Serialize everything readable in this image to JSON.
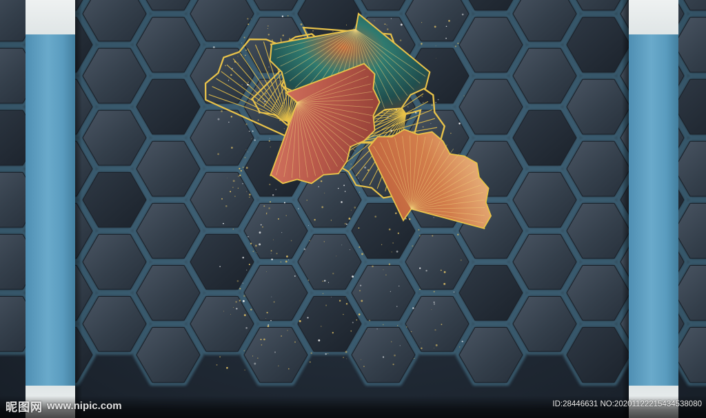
{
  "scene": {
    "subject": "ginkgo-leaves-on-hexagon-wall",
    "palette": {
      "background": "#1f2833",
      "hex_face": "#38434f",
      "hex_glow": "#6fc3e8",
      "pillar_blue": "#5a9cbf",
      "pillar_cap": "#e8ecec",
      "gold_line": "#e8c24a",
      "leaf_red": "#c8604e",
      "leaf_orange": "#d57a45",
      "leaf_teal": "#2b6f6a"
    },
    "icons": [
      "nipic-logo-icon",
      "ginkgo-leaf-icon",
      "hexagon-tile-icon"
    ]
  },
  "watermark": {
    "brand": "昵图网",
    "url": "www.nipic.com",
    "id_text": "ID:28446631 NO:20201122215434538080"
  }
}
